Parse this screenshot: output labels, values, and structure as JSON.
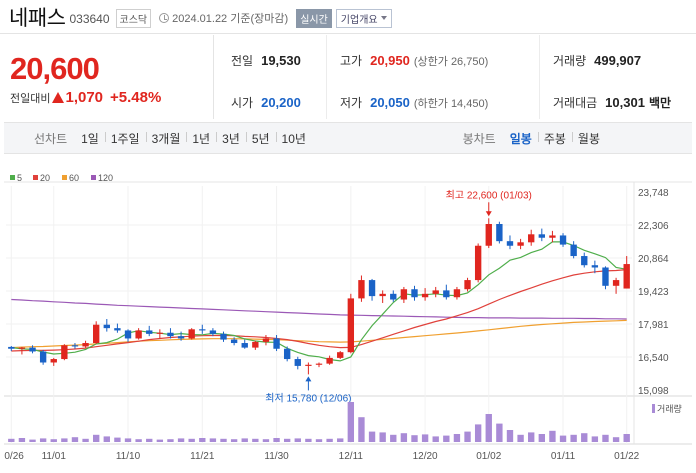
{
  "header": {
    "name": "네패스",
    "code": "033640",
    "market": "코스닥",
    "date": "2024.01.22",
    "basis": "기준(장마감)",
    "realtime": "실시간",
    "company_overview": "기업개요"
  },
  "price": {
    "current": "20,600",
    "change_label": "전일대비",
    "change_amount": "1,070",
    "change_percent": "+5.48%"
  },
  "stats": {
    "prev_close": {
      "label": "전일",
      "value": "19,530"
    },
    "high": {
      "label": "고가",
      "value": "20,950",
      "sub": "(상한가 26,750)"
    },
    "volume": {
      "label": "거래량",
      "value": "499,907"
    },
    "open": {
      "label": "시가",
      "value": "20,200"
    },
    "low": {
      "label": "저가",
      "value": "20,050",
      "sub": "(하한가 14,450)"
    },
    "amount": {
      "label": "거래대금",
      "value": "10,301",
      "unit": "백만"
    }
  },
  "tabs": {
    "line_label": "선차트",
    "line_items": [
      "1일",
      "1주일",
      "3개월",
      "1년",
      "3년",
      "5년",
      "10년"
    ],
    "candle_label": "봉차트",
    "candle_items": [
      "일봉",
      "주봉",
      "월봉"
    ],
    "candle_active": 0
  },
  "colors": {
    "up": "#e0261f",
    "down": "#1a63c7",
    "ma5": "#4fae4b",
    "ma20": "#e0413b",
    "ma60": "#f0a030",
    "ma120": "#9b59b6",
    "volume": "#a98bd6"
  },
  "chart_data": {
    "type": "candlestick",
    "legend": [
      {
        "name": "5",
        "color": "#4fae4b"
      },
      {
        "name": "20",
        "color": "#e0413b"
      },
      {
        "name": "60",
        "color": "#f0a030"
      },
      {
        "name": "120",
        "color": "#9b59b6"
      }
    ],
    "y_ticks": [
      "23,748",
      "22,306",
      "20,864",
      "19,423",
      "17,981",
      "16,540",
      "15,098"
    ],
    "ylim": [
      15098,
      23748
    ],
    "x_ticks": [
      "10/26",
      "11/01",
      "11/10",
      "11/21",
      "11/30",
      "12/11",
      "12/20",
      "01/02",
      "01/11",
      "01/22"
    ],
    "x_tick_index": [
      0,
      4,
      11,
      18,
      25,
      32,
      39,
      45,
      52,
      58
    ],
    "annotations": {
      "high": {
        "text": "최고 22,600 (01/03)",
        "index": 45,
        "value": 22600
      },
      "low": {
        "text": "최저 15,780 (12/06)",
        "index": 28,
        "value": 15780
      }
    },
    "volume_label": "거래량",
    "candles": [
      [
        16980,
        17020,
        16800,
        16900
      ],
      [
        16900,
        16980,
        16650,
        16950
      ],
      [
        16950,
        17050,
        16700,
        16780
      ],
      [
        16780,
        16850,
        16200,
        16300
      ],
      [
        16300,
        16500,
        16150,
        16450
      ],
      [
        16450,
        17100,
        16400,
        17050
      ],
      [
        17050,
        17150,
        16900,
        17000
      ],
      [
        17000,
        17250,
        16950,
        17150
      ],
      [
        17150,
        18100,
        17100,
        17950
      ],
      [
        17950,
        18200,
        17650,
        17800
      ],
      [
        17800,
        18000,
        17600,
        17700
      ],
      [
        17700,
        17750,
        17200,
        17350
      ],
      [
        17350,
        17800,
        17300,
        17700
      ],
      [
        17700,
        17900,
        17450,
        17550
      ],
      [
        17550,
        17750,
        17350,
        17600
      ],
      [
        17600,
        17800,
        17350,
        17450
      ],
      [
        17450,
        17650,
        17250,
        17350
      ],
      [
        17350,
        17800,
        17300,
        17750
      ],
      [
        17750,
        17950,
        17550,
        17700
      ],
      [
        17700,
        17800,
        17450,
        17550
      ],
      [
        17550,
        17650,
        17200,
        17300
      ],
      [
        17300,
        17400,
        17050,
        17150
      ],
      [
        17150,
        17300,
        16900,
        16950
      ],
      [
        16950,
        17250,
        16850,
        17200
      ],
      [
        17200,
        17500,
        17050,
        17350
      ],
      [
        17350,
        17500,
        16800,
        16900
      ],
      [
        16900,
        17000,
        16350,
        16450
      ],
      [
        16450,
        16550,
        16000,
        16150
      ],
      [
        16150,
        16300,
        15780,
        16200
      ],
      [
        16200,
        16300,
        16100,
        16250
      ],
      [
        16250,
        16600,
        16200,
        16500
      ],
      [
        16500,
        16800,
        16450,
        16750
      ],
      [
        16750,
        19300,
        16700,
        19100
      ],
      [
        19100,
        20100,
        18950,
        19900
      ],
      [
        19900,
        19950,
        19000,
        19200
      ],
      [
        19200,
        19450,
        18900,
        19300
      ],
      [
        19300,
        19450,
        18950,
        19050
      ],
      [
        19050,
        19600,
        18900,
        19500
      ],
      [
        19500,
        19650,
        19000,
        19150
      ],
      [
        19150,
        19550,
        19000,
        19300
      ],
      [
        19300,
        19600,
        19150,
        19450
      ],
      [
        19450,
        19700,
        19050,
        19150
      ],
      [
        19150,
        19600,
        19050,
        19500
      ],
      [
        19500,
        20000,
        19400,
        19900
      ],
      [
        19900,
        21500,
        19800,
        21400
      ],
      [
        21400,
        22600,
        21300,
        22350
      ],
      [
        22350,
        22450,
        21500,
        21600
      ],
      [
        21600,
        21850,
        21250,
        21400
      ],
      [
        21400,
        21700,
        21250,
        21550
      ],
      [
        21550,
        22100,
        21400,
        21900
      ],
      [
        21900,
        22150,
        21600,
        21750
      ],
      [
        21750,
        22050,
        21550,
        21850
      ],
      [
        21850,
        21950,
        21350,
        21450
      ],
      [
        21450,
        21600,
        20850,
        20950
      ],
      [
        20950,
        21100,
        20450,
        20550
      ],
      [
        20550,
        20750,
        20200,
        20450
      ],
      [
        20450,
        20500,
        19500,
        19650
      ],
      [
        19650,
        20000,
        19300,
        19900
      ],
      [
        19530,
        20950,
        20050,
        20600
      ]
    ],
    "ma5": [
      16950,
      16900,
      16870,
      16760,
      16670,
      16700,
      16750,
      16870,
      17110,
      17170,
      17320,
      17590,
      17690,
      17620,
      17580,
      17520,
      17560,
      17520,
      17510,
      17570,
      17540,
      17480,
      17330,
      17240,
      17190,
      17180,
      16920,
      16740,
      16600,
      16550,
      16430,
      16370,
      16540,
      17290,
      17910,
      18410,
      18920,
      19300,
      19240,
      19260,
      19300,
      19240,
      19220,
      19340,
      19700,
      20130,
      20420,
      20770,
      20890,
      21100,
      21250,
      21570,
      21570,
      21410,
      21200,
      21050,
      20880,
      20450,
      20370
    ],
    "ma20": [
      16800,
      16820,
      16830,
      16830,
      16840,
      16860,
      16890,
      16930,
      16990,
      17050,
      17110,
      17170,
      17230,
      17300,
      17350,
      17390,
      17420,
      17450,
      17470,
      17480,
      17480,
      17470,
      17440,
      17420,
      17390,
      17350,
      17300,
      17220,
      17130,
      17050,
      16990,
      16950,
      16960,
      17080,
      17230,
      17380,
      17530,
      17680,
      17830,
      17960,
      18090,
      18200,
      18340,
      18480,
      18650,
      18850,
      19050,
      19230,
      19400,
      19560,
      19720,
      19870,
      20000,
      20120,
      20200,
      20260,
      20300,
      20320,
      20360
    ],
    "ma60": [
      16950,
      16970,
      16990,
      17000,
      17020,
      17040,
      17060,
      17080,
      17110,
      17140,
      17170,
      17200,
      17230,
      17250,
      17270,
      17290,
      17310,
      17320,
      17330,
      17340,
      17340,
      17340,
      17330,
      17320,
      17310,
      17300,
      17280,
      17250,
      17230,
      17210,
      17200,
      17190,
      17200,
      17230,
      17270,
      17310,
      17350,
      17390,
      17430,
      17470,
      17510,
      17550,
      17590,
      17630,
      17680,
      17730,
      17780,
      17830,
      17880,
      17920,
      17960,
      17990,
      18020,
      18050,
      18070,
      18090,
      18110,
      18120,
      18140
    ],
    "ma120": [
      19050,
      19030,
      19000,
      18980,
      18950,
      18930,
      18900,
      18880,
      18850,
      18830,
      18800,
      18780,
      18760,
      18740,
      18720,
      18700,
      18680,
      18660,
      18640,
      18620,
      18600,
      18580,
      18560,
      18540,
      18520,
      18500,
      18480,
      18460,
      18440,
      18420,
      18400,
      18380,
      18370,
      18360,
      18350,
      18340,
      18330,
      18320,
      18310,
      18300,
      18290,
      18280,
      18270,
      18260,
      18260,
      18250,
      18250,
      18250,
      18240,
      18240,
      18240,
      18230,
      18230,
      18230,
      18220,
      18220,
      18210,
      18210,
      18200
    ],
    "volume": [
      8,
      10,
      6,
      9,
      7,
      9,
      12,
      8,
      18,
      14,
      11,
      9,
      7,
      8,
      6,
      7,
      9,
      8,
      10,
      9,
      8,
      7,
      9,
      8,
      7,
      10,
      8,
      9,
      8,
      7,
      8,
      9,
      100,
      62,
      26,
      24,
      18,
      22,
      17,
      19,
      14,
      16,
      20,
      26,
      44,
      70,
      46,
      30,
      18,
      24,
      20,
      28,
      16,
      18,
      22,
      14,
      18,
      12,
      20
    ]
  }
}
